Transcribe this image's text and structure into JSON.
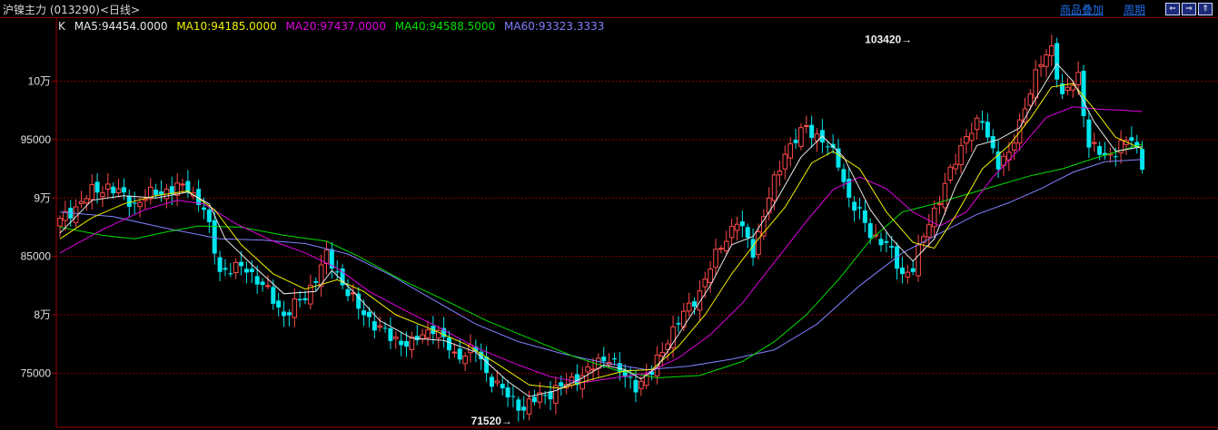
{
  "header": {
    "title": "沪镍主力 (013290)<日线>",
    "links": [
      "商品叠加",
      "周期"
    ],
    "nav_buttons": [
      "⇐",
      "⇒",
      "⇑"
    ]
  },
  "legend": {
    "k_label": "K",
    "ma5": "MA5:94454.0000",
    "ma10": "MA10:94185.0000",
    "ma20": "MA20:97437.0000",
    "ma40": "MA40:94588.5000",
    "ma60": "MA60:93323.3333"
  },
  "colors": {
    "up": "#ff4a4a",
    "down": "#00e5ee",
    "ma5": "#e8e8e8",
    "ma10": "#f0f000",
    "ma20": "#e000e0",
    "ma40": "#00e000",
    "ma60": "#8080ff",
    "grid": "#8b0000",
    "frame": "#9a0000"
  },
  "chart_data": {
    "type": "candlestick",
    "y_ticks": [
      {
        "value": 100000,
        "label": "10万"
      },
      {
        "value": 95000,
        "label": "95000"
      },
      {
        "value": 90000,
        "label": "9万"
      },
      {
        "value": 85000,
        "label": "85000"
      },
      {
        "value": 80000,
        "label": "8万"
      },
      {
        "value": 75000,
        "label": "75000"
      }
    ],
    "ylim": [
      70300,
      105500
    ],
    "annotations": [
      {
        "text": "103420→",
        "value": 103420,
        "index": 160
      },
      {
        "text": "71520→",
        "value": 71520,
        "index": 85
      }
    ],
    "close_path": [
      [
        0,
        88000
      ],
      [
        6,
        90500
      ],
      [
        9,
        91000
      ],
      [
        14,
        89500
      ],
      [
        18,
        90500
      ],
      [
        21,
        90700
      ],
      [
        24,
        91000
      ],
      [
        27,
        89000
      ],
      [
        30,
        83800
      ],
      [
        35,
        84000
      ],
      [
        38,
        82500
      ],
      [
        42,
        80000
      ],
      [
        46,
        81500
      ],
      [
        50,
        85000
      ],
      [
        52,
        83500
      ],
      [
        56,
        80500
      ],
      [
        62,
        78000
      ],
      [
        66,
        77500
      ],
      [
        70,
        79000
      ],
      [
        74,
        76500
      ],
      [
        78,
        77000
      ],
      [
        80,
        75000
      ],
      [
        84,
        73000
      ],
      [
        87,
        72000
      ],
      [
        90,
        73000
      ],
      [
        95,
        74000
      ],
      [
        100,
        75500
      ],
      [
        103,
        76500
      ],
      [
        106,
        74500
      ],
      [
        108,
        74000
      ],
      [
        111,
        75000
      ],
      [
        114,
        78000
      ],
      [
        120,
        82000
      ],
      [
        124,
        86000
      ],
      [
        127,
        88000
      ],
      [
        130,
        85500
      ],
      [
        133,
        90000
      ],
      [
        136,
        94000
      ],
      [
        140,
        96000
      ],
      [
        143,
        95000
      ],
      [
        146,
        93000
      ],
      [
        148,
        90000
      ],
      [
        152,
        87000
      ],
      [
        155,
        86000
      ],
      [
        158,
        83500
      ],
      [
        160,
        84000
      ],
      [
        163,
        88000
      ],
      [
        166,
        91000
      ],
      [
        170,
        95500
      ],
      [
        173,
        96500
      ],
      [
        176,
        93000
      ],
      [
        178,
        93500
      ],
      [
        181,
        98000
      ],
      [
        184,
        101500
      ],
      [
        186,
        103000
      ],
      [
        188,
        98500
      ],
      [
        191,
        100500
      ],
      [
        193,
        94500
      ],
      [
        196,
        93500
      ],
      [
        199,
        94500
      ],
      [
        201,
        95000
      ],
      [
        203,
        93000
      ]
    ],
    "ma5_path": [
      [
        0,
        87000
      ],
      [
        6,
        89800
      ],
      [
        12,
        90200
      ],
      [
        18,
        90000
      ],
      [
        24,
        90500
      ],
      [
        28,
        89500
      ],
      [
        31,
        86500
      ],
      [
        36,
        84300
      ],
      [
        42,
        81800
      ],
      [
        48,
        82000
      ],
      [
        51,
        83800
      ],
      [
        55,
        82000
      ],
      [
        60,
        79500
      ],
      [
        66,
        78000
      ],
      [
        72,
        77800
      ],
      [
        78,
        76800
      ],
      [
        84,
        74300
      ],
      [
        88,
        73000
      ],
      [
        93,
        73500
      ],
      [
        98,
        74600
      ],
      [
        102,
        75700
      ],
      [
        106,
        75300
      ],
      [
        109,
        74500
      ],
      [
        112,
        75500
      ],
      [
        117,
        79000
      ],
      [
        122,
        82500
      ],
      [
        126,
        86000
      ],
      [
        130,
        86700
      ],
      [
        134,
        89500
      ],
      [
        139,
        93500
      ],
      [
        143,
        95300
      ],
      [
        147,
        93500
      ],
      [
        152,
        89000
      ],
      [
        156,
        86500
      ],
      [
        160,
        84600
      ],
      [
        164,
        86500
      ],
      [
        168,
        91000
      ],
      [
        172,
        94500
      ],
      [
        176,
        95000
      ],
      [
        180,
        96000
      ],
      [
        183,
        98500
      ],
      [
        187,
        101500
      ],
      [
        190,
        100000
      ],
      [
        194,
        96500
      ],
      [
        198,
        94000
      ],
      [
        203,
        94400
      ]
    ],
    "ma10_path": [
      [
        0,
        86500
      ],
      [
        6,
        88300
      ],
      [
        12,
        89500
      ],
      [
        18,
        90200
      ],
      [
        24,
        90600
      ],
      [
        29,
        89000
      ],
      [
        34,
        86000
      ],
      [
        40,
        83500
      ],
      [
        46,
        82200
      ],
      [
        52,
        83000
      ],
      [
        57,
        82000
      ],
      [
        63,
        80000
      ],
      [
        70,
        78700
      ],
      [
        76,
        77500
      ],
      [
        82,
        75800
      ],
      [
        88,
        74000
      ],
      [
        94,
        73700
      ],
      [
        100,
        74500
      ],
      [
        106,
        75200
      ],
      [
        111,
        75300
      ],
      [
        116,
        77300
      ],
      [
        121,
        80000
      ],
      [
        126,
        83500
      ],
      [
        131,
        86500
      ],
      [
        136,
        89200
      ],
      [
        141,
        93000
      ],
      [
        145,
        94000
      ],
      [
        150,
        92500
      ],
      [
        155,
        88800
      ],
      [
        160,
        86200
      ],
      [
        164,
        85700
      ],
      [
        168,
        88500
      ],
      [
        173,
        92500
      ],
      [
        178,
        94500
      ],
      [
        182,
        96800
      ],
      [
        186,
        99500
      ],
      [
        190,
        99800
      ],
      [
        194,
        97600
      ],
      [
        198,
        95200
      ],
      [
        203,
        94200
      ]
    ],
    "ma20_path": [
      [
        0,
        85300
      ],
      [
        8,
        87300
      ],
      [
        16,
        89000
      ],
      [
        22,
        89800
      ],
      [
        27,
        89500
      ],
      [
        33,
        87800
      ],
      [
        40,
        86300
      ],
      [
        46,
        85300
      ],
      [
        52,
        84000
      ],
      [
        58,
        82000
      ],
      [
        65,
        80300
      ],
      [
        72,
        78700
      ],
      [
        78,
        77200
      ],
      [
        86,
        75700
      ],
      [
        92,
        74700
      ],
      [
        98,
        74200
      ],
      [
        104,
        74600
      ],
      [
        110,
        75000
      ],
      [
        116,
        76300
      ],
      [
        122,
        78300
      ],
      [
        128,
        81000
      ],
      [
        134,
        84500
      ],
      [
        140,
        88000
      ],
      [
        145,
        90700
      ],
      [
        150,
        91800
      ],
      [
        155,
        90800
      ],
      [
        160,
        88800
      ],
      [
        165,
        87600
      ],
      [
        170,
        88800
      ],
      [
        175,
        91800
      ],
      [
        180,
        94200
      ],
      [
        185,
        96900
      ],
      [
        190,
        97800
      ],
      [
        195,
        97600
      ],
      [
        200,
        97500
      ],
      [
        203,
        97400
      ]
    ],
    "ma40_path": [
      [
        0,
        87500
      ],
      [
        8,
        86800
      ],
      [
        14,
        86500
      ],
      [
        20,
        87100
      ],
      [
        26,
        87600
      ],
      [
        34,
        87500
      ],
      [
        42,
        86800
      ],
      [
        50,
        86300
      ],
      [
        56,
        85000
      ],
      [
        64,
        83000
      ],
      [
        72,
        81300
      ],
      [
        80,
        79500
      ],
      [
        88,
        78000
      ],
      [
        96,
        76500
      ],
      [
        104,
        75300
      ],
      [
        112,
        74600
      ],
      [
        120,
        74800
      ],
      [
        128,
        76000
      ],
      [
        134,
        77700
      ],
      [
        140,
        80000
      ],
      [
        146,
        83000
      ],
      [
        152,
        86400
      ],
      [
        158,
        88800
      ],
      [
        164,
        89500
      ],
      [
        170,
        90300
      ],
      [
        176,
        91100
      ],
      [
        182,
        91900
      ],
      [
        188,
        92500
      ],
      [
        194,
        93400
      ],
      [
        203,
        94600
      ]
    ],
    "ma60_path": [
      [
        0,
        88800
      ],
      [
        10,
        88400
      ],
      [
        20,
        87400
      ],
      [
        30,
        86500
      ],
      [
        38,
        86400
      ],
      [
        46,
        86100
      ],
      [
        54,
        85200
      ],
      [
        62,
        83400
      ],
      [
        70,
        81300
      ],
      [
        78,
        79200
      ],
      [
        86,
        77700
      ],
      [
        94,
        76700
      ],
      [
        102,
        75900
      ],
      [
        110,
        75300
      ],
      [
        118,
        75600
      ],
      [
        126,
        76200
      ],
      [
        134,
        77000
      ],
      [
        142,
        79200
      ],
      [
        150,
        82500
      ],
      [
        158,
        85300
      ],
      [
        166,
        87200
      ],
      [
        172,
        88600
      ],
      [
        178,
        89600
      ],
      [
        184,
        90800
      ],
      [
        190,
        92200
      ],
      [
        196,
        93100
      ],
      [
        203,
        93300
      ]
    ]
  }
}
